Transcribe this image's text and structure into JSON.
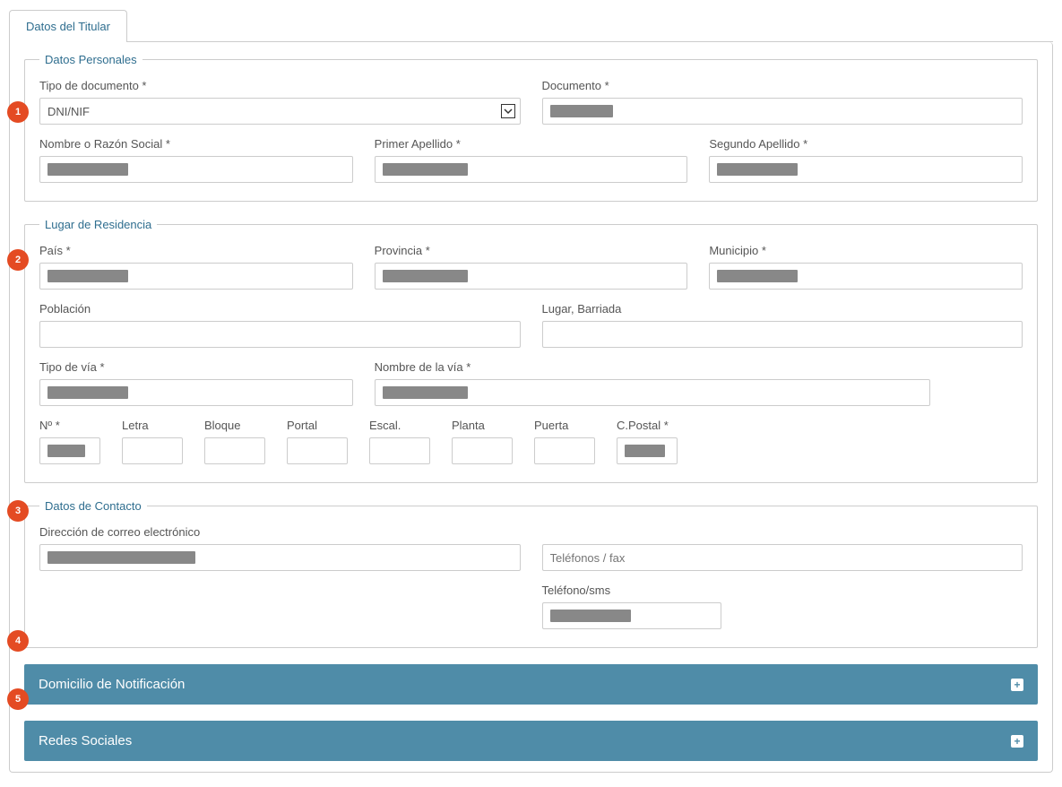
{
  "badges": [
    "1",
    "2",
    "3",
    "4",
    "5"
  ],
  "tabs": {
    "datos_titular": "Datos del Titular"
  },
  "personal": {
    "legend": "Datos Personales",
    "tipo_documento_label": "Tipo de documento *",
    "tipo_documento_value": "DNI/NIF",
    "documento_label": "Documento *",
    "nombre_label": "Nombre o Razón Social *",
    "primer_apellido_label": "Primer Apellido *",
    "segundo_apellido_label": "Segundo Apellido *"
  },
  "residencia": {
    "legend": "Lugar de Residencia",
    "pais_label": "País *",
    "provincia_label": "Provincia *",
    "municipio_label": "Municipio *",
    "poblacion_label": "Población",
    "lugar_barriada_label": "Lugar, Barriada",
    "tipo_via_label": "Tipo de vía *",
    "nombre_via_label": "Nombre de la vía *",
    "numero_label": "Nº *",
    "letra_label": "Letra",
    "bloque_label": "Bloque",
    "portal_label": "Portal",
    "escal_label": "Escal.",
    "planta_label": "Planta",
    "puerta_label": "Puerta",
    "cpostal_label": "C.Postal *"
  },
  "contacto": {
    "legend": "Datos de Contacto",
    "email_label": "Dirección de correo electrónico",
    "telefonos_placeholder": "Teléfonos / fax",
    "telefono_sms_label": "Teléfono/sms"
  },
  "accordions": {
    "domicilio": "Domicilio de Notificación",
    "redes": "Redes Sociales"
  },
  "redacted_widths": {
    "documento": 70,
    "nombre": 90,
    "primer_apellido": 95,
    "segundo_apellido": 90,
    "pais": 90,
    "provincia": 95,
    "municipio": 90,
    "tipo_via": 90,
    "nombre_via": 95,
    "numero": 42,
    "cpostal": 45,
    "email": 165,
    "telefono_sms": 90
  }
}
